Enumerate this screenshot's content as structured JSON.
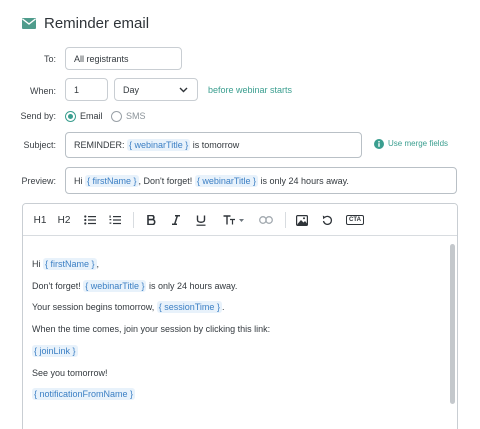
{
  "header": {
    "title": "Reminder email"
  },
  "form": {
    "to": {
      "label": "To:",
      "value": "All registrants"
    },
    "when": {
      "label": "When:",
      "number": "1",
      "unit": "Day",
      "suffix": "before webinar starts"
    },
    "send_by": {
      "label": "Send by:",
      "options": [
        "Email",
        "SMS"
      ],
      "selected": "Email"
    },
    "subject": {
      "label": "Subject:",
      "prefix": "REMINDER:",
      "merge": "{ webinarTitle }",
      "suffix": "is tomorrow",
      "merge_link": "Use merge fields"
    },
    "preview": {
      "label": "Preview:",
      "part1": "Hi",
      "merge1": "{ firstName }",
      "part2": ", Don't forget!",
      "merge2": "{ webinarTitle }",
      "part3": "is only 24 hours away."
    }
  },
  "toolbar": {
    "h1": "H1",
    "h2": "H2",
    "cta": "CTA"
  },
  "editor": {
    "line1_a": "Hi",
    "line1_merge": "{ firstName }",
    "line1_b": ",",
    "line2_a": "Don't forget!",
    "line2_merge": "{ webinarTitle }",
    "line2_b": "is only 24 hours away.",
    "line3_a": "Your session begins tomorrow,",
    "line3_merge": "{ sessionTime }",
    "line3_b": ".",
    "line4": "When the time comes, join your session by clicking this link:",
    "line5_merge": "{ joinLink }",
    "line6": "See you tomorrow!",
    "line7_merge": "{ notificationFromName }"
  },
  "colors": {
    "accent": "#3a9e8f",
    "merge_bg": "#e8f2fb",
    "merge_text": "#3b7fc4"
  }
}
